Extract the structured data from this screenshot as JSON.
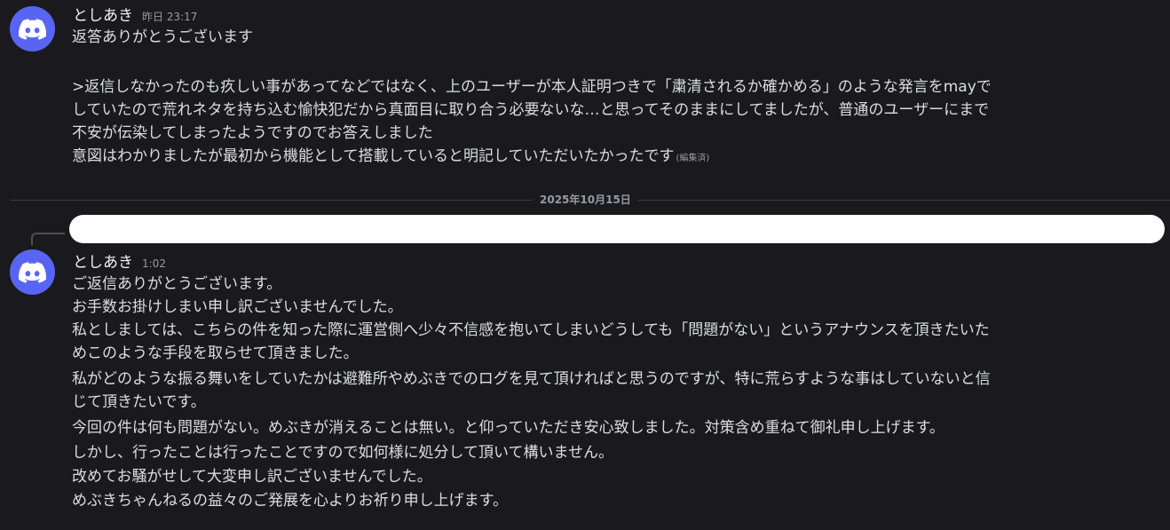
{
  "colors": {
    "background": "#1a1a1e",
    "avatar": "#5865f2",
    "username": "#f2f3f5",
    "text": "#dbdee1",
    "muted": "#949ba4"
  },
  "messages": [
    {
      "avatar_icon": "discord-logo-icon",
      "username": "としあき",
      "timestamp": "昨日 23:17",
      "lines": [
        "返答ありがとうございます",
        "",
        ">返信しなかったのも疚しい事があってなどではなく、上のユーザーが本人証明つきで「粛清されるか確かめる」のような発言をmayで",
        "していたので荒れネタを持ち込む愉快犯だから真面目に取り合う必要ないな…と思ってそのままにしてましたが、普通のユーザーにまで",
        "不安が伝染してしまったようですのでお答えしました",
        "意図はわかりましたが最初から機能として搭載していると明記していただいたかったです"
      ],
      "edited_label": "(編集済)"
    },
    {
      "avatar_icon": "discord-logo-icon",
      "username": "としあき",
      "timestamp": "1:02",
      "lines": [
        "ご返信ありがとうございます。",
        "お手数お掛けしまい申し訳ございませんでした。",
        "私としましては、こちらの件を知った際に運営側へ少々不信感を抱いてしまいどうしても「問題がない」というアナウンスを頂きたいた",
        "めこのような手段を取らせて頂きました。",
        "私がどのような振る舞いをしていたかは避難所やめぶきでのログを見て頂ければと思うのですが、特に荒らすような事はしていないと信",
        "じて頂きたいです。",
        "今回の件は何も問題がない。めぶきが消えることは無い。と仰っていただき安心致しました。対策含め重ねて御礼申し上げます。",
        "しかし、行ったことは行ったことですので如何様に処分して頂いて構いません。",
        "改めてお騒がせして大変申し訳ございませんでした。",
        "めぶきちゃんねるの益々のご発展を心よりお祈り申し上げます。"
      ]
    }
  ],
  "date_divider": "2025年10月15日"
}
